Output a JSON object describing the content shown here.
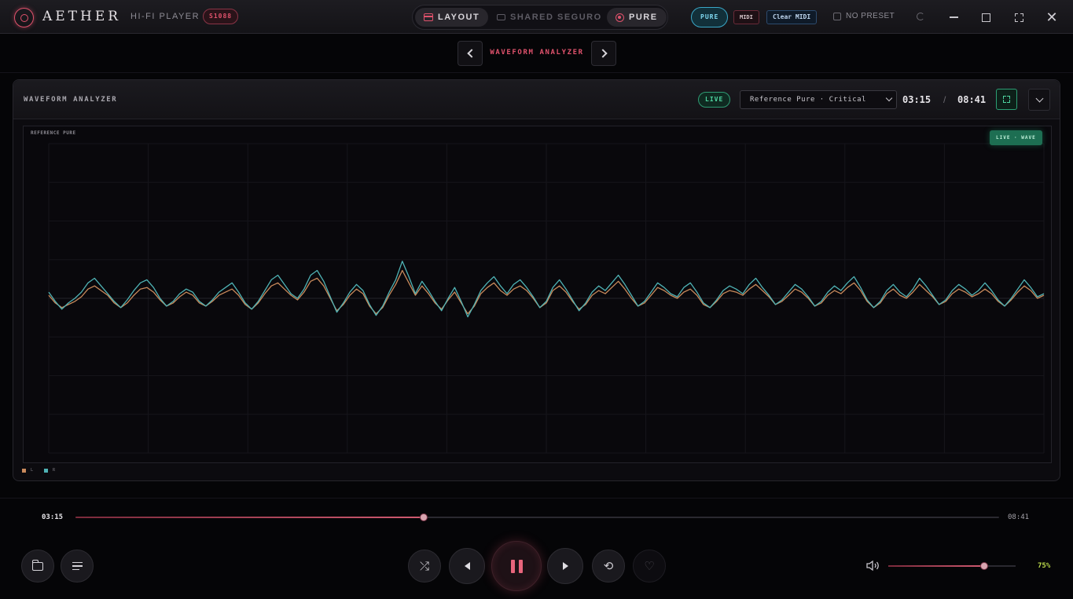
{
  "header": {
    "brand": "AETHER",
    "subbrand": "HI-FI PLAYER",
    "badge": "S1088",
    "segments": {
      "layout": "LAYOUT",
      "shared": "SHARED SEGURO",
      "pure": "PURE"
    },
    "pure_pill": "PURE",
    "midi": "MIDI",
    "clear_midi": "Clear MIDI",
    "preset": "NO PRESET"
  },
  "view": {
    "title": "WAVEFORM ANALYZER"
  },
  "panel": {
    "title": "WAVEFORM ANALYZER",
    "live": "LIVE",
    "mode_select": "Reference Pure · Critical",
    "current_time": "03:15",
    "separator": "/",
    "total_time": "08:41",
    "plot_label": "REFERENCE PURE",
    "plot_badge": "LIVE · WAVE",
    "legend": [
      {
        "label": "L",
        "color": "#c98a5c"
      },
      {
        "label": "R",
        "color": "#4fb3b5"
      }
    ]
  },
  "chart_data": {
    "type": "line",
    "title": "",
    "xlabel": "",
    "ylabel": "",
    "ylim": [
      -1,
      1
    ],
    "grid": true,
    "series": [
      {
        "name": "L",
        "color": "#c98a5c",
        "values": [
          0.02,
          -0.03,
          -0.06,
          -0.04,
          -0.02,
          0.01,
          0.06,
          0.08,
          0.05,
          0.02,
          -0.03,
          -0.06,
          -0.03,
          0.02,
          0.06,
          0.07,
          0.04,
          -0.01,
          -0.05,
          -0.03,
          0.01,
          0.04,
          0.02,
          -0.03,
          -0.05,
          -0.02,
          0.02,
          0.04,
          0.06,
          0.02,
          -0.04,
          -0.07,
          -0.03,
          0.03,
          0.08,
          0.1,
          0.06,
          0.02,
          -0.01,
          0.04,
          0.11,
          0.13,
          0.08,
          0.0,
          -0.08,
          -0.04,
          0.02,
          0.06,
          0.03,
          -0.05,
          -0.1,
          -0.06,
          0.02,
          0.09,
          0.18,
          0.1,
          0.02,
          0.08,
          0.03,
          -0.03,
          -0.07,
          -0.01,
          0.04,
          -0.03,
          -0.1,
          -0.05,
          0.03,
          0.07,
          0.1,
          0.05,
          0.02,
          0.06,
          0.08,
          0.05,
          0.0,
          -0.06,
          -0.03,
          0.05,
          0.08,
          0.04,
          -0.02,
          -0.07,
          -0.04,
          0.02,
          0.05,
          0.03,
          0.07,
          0.11,
          0.06,
          0.0,
          -0.05,
          -0.03,
          0.02,
          0.07,
          0.05,
          0.02,
          0.0,
          0.04,
          0.06,
          0.02,
          -0.04,
          -0.06,
          -0.02,
          0.03,
          0.05,
          0.04,
          0.02,
          0.06,
          0.09,
          0.05,
          0.01,
          -0.04,
          -0.02,
          0.02,
          0.06,
          0.04,
          0.0,
          -0.05,
          -0.03,
          0.02,
          0.05,
          0.03,
          0.07,
          0.1,
          0.05,
          -0.02,
          -0.06,
          -0.03,
          0.03,
          0.06,
          0.02,
          0.0,
          0.04,
          0.09,
          0.05,
          0.01,
          -0.04,
          -0.02,
          0.03,
          0.06,
          0.04,
          0.01,
          0.03,
          0.06,
          0.03,
          -0.02,
          -0.05,
          -0.01,
          0.04,
          0.08,
          0.05,
          0.0,
          0.02
        ]
      },
      {
        "name": "R",
        "color": "#4fb3b5",
        "values": [
          0.04,
          -0.02,
          -0.07,
          -0.03,
          0.0,
          0.04,
          0.1,
          0.13,
          0.08,
          0.03,
          -0.02,
          -0.06,
          -0.01,
          0.05,
          0.1,
          0.12,
          0.07,
          0.0,
          -0.05,
          -0.02,
          0.03,
          0.06,
          0.04,
          -0.02,
          -0.05,
          -0.01,
          0.04,
          0.07,
          0.1,
          0.04,
          -0.03,
          -0.07,
          -0.02,
          0.05,
          0.12,
          0.15,
          0.09,
          0.03,
          0.0,
          0.06,
          0.15,
          0.18,
          0.11,
          0.01,
          -0.09,
          -0.03,
          0.04,
          0.09,
          0.05,
          -0.04,
          -0.11,
          -0.05,
          0.04,
          0.12,
          0.24,
          0.14,
          0.03,
          0.11,
          0.05,
          -0.02,
          -0.08,
          0.0,
          0.07,
          -0.02,
          -0.12,
          -0.04,
          0.05,
          0.1,
          0.14,
          0.08,
          0.03,
          0.09,
          0.12,
          0.07,
          0.01,
          -0.06,
          -0.02,
          0.07,
          0.12,
          0.06,
          -0.01,
          -0.08,
          -0.03,
          0.04,
          0.08,
          0.05,
          0.1,
          0.15,
          0.09,
          0.02,
          -0.05,
          -0.02,
          0.04,
          0.1,
          0.07,
          0.03,
          0.01,
          0.07,
          0.1,
          0.04,
          -0.03,
          -0.06,
          -0.01,
          0.05,
          0.08,
          0.06,
          0.03,
          0.09,
          0.13,
          0.07,
          0.02,
          -0.04,
          -0.01,
          0.04,
          0.09,
          0.06,
          0.01,
          -0.05,
          -0.02,
          0.04,
          0.08,
          0.05,
          0.1,
          0.14,
          0.07,
          -0.01,
          -0.06,
          -0.02,
          0.05,
          0.09,
          0.04,
          0.01,
          0.06,
          0.13,
          0.08,
          0.02,
          -0.04,
          -0.01,
          0.05,
          0.09,
          0.06,
          0.02,
          0.05,
          0.1,
          0.05,
          -0.01,
          -0.05,
          0.0,
          0.06,
          0.12,
          0.07,
          0.01,
          0.03
        ]
      }
    ]
  },
  "playback": {
    "current": "03:15",
    "total": "08:41",
    "progress": 0.377,
    "volume": 0.75,
    "volume_label": "75%"
  },
  "colors": {
    "accent": "#e0526c",
    "live": "#4fd6a1",
    "cyan": "#3aa7c7",
    "volume": "#b9d84a"
  }
}
